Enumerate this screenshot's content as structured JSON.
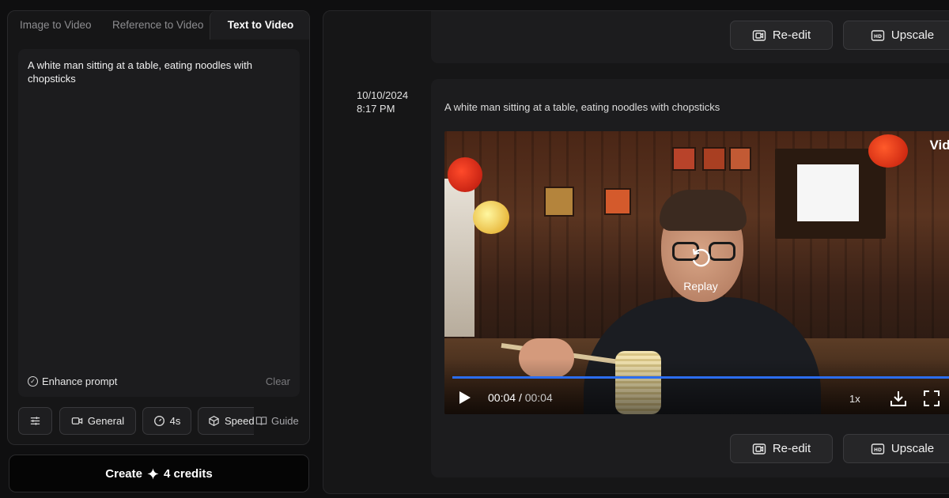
{
  "tabs": [
    {
      "label": "Image to Video",
      "active": false
    },
    {
      "label": "Reference to Video",
      "active": false
    },
    {
      "label": "Text to Video",
      "active": true
    }
  ],
  "prompt": {
    "value": "A white man sitting at a table, eating noodles with chopsticks",
    "enhance_label": "Enhance prompt",
    "clear_label": "Clear"
  },
  "options": {
    "model_label": "General",
    "duration_label": "4s",
    "speed_label": "Speed",
    "guide_label": "Guide"
  },
  "create": {
    "label": "Create",
    "credits": "4 credits"
  },
  "history": {
    "top_card": {
      "reedit_label": "Re-edit",
      "upscale_label": "Upscale"
    },
    "entry": {
      "date": "10/10/2024",
      "time": "8:17 PM",
      "caption": "A white man sitting at a table, eating noodles with chopsticks",
      "video": {
        "watermark": "Vidu",
        "replay_label": "Replay",
        "current_time": "00:04",
        "separator": "/",
        "total_time": "00:04",
        "progress": 1.0,
        "speed": "1x"
      },
      "reedit_label": "Re-edit",
      "upscale_label": "Upscale"
    }
  },
  "colors": {
    "accent": "#2b6df0",
    "panel": "#161617",
    "card": "#1c1c1e"
  }
}
